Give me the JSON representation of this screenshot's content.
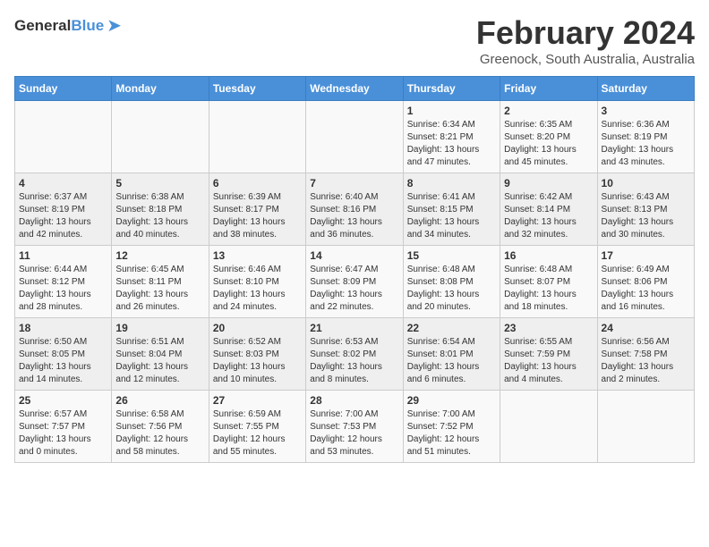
{
  "logo": {
    "general": "General",
    "blue": "Blue"
  },
  "title": "February 2024",
  "subtitle": "Greenock, South Australia, Australia",
  "days_of_week": [
    "Sunday",
    "Monday",
    "Tuesday",
    "Wednesday",
    "Thursday",
    "Friday",
    "Saturday"
  ],
  "weeks": [
    [
      {
        "day": "",
        "detail": ""
      },
      {
        "day": "",
        "detail": ""
      },
      {
        "day": "",
        "detail": ""
      },
      {
        "day": "",
        "detail": ""
      },
      {
        "day": "1",
        "detail": "Sunrise: 6:34 AM\nSunset: 8:21 PM\nDaylight: 13 hours and 47 minutes."
      },
      {
        "day": "2",
        "detail": "Sunrise: 6:35 AM\nSunset: 8:20 PM\nDaylight: 13 hours and 45 minutes."
      },
      {
        "day": "3",
        "detail": "Sunrise: 6:36 AM\nSunset: 8:19 PM\nDaylight: 13 hours and 43 minutes."
      }
    ],
    [
      {
        "day": "4",
        "detail": "Sunrise: 6:37 AM\nSunset: 8:19 PM\nDaylight: 13 hours and 42 minutes."
      },
      {
        "day": "5",
        "detail": "Sunrise: 6:38 AM\nSunset: 8:18 PM\nDaylight: 13 hours and 40 minutes."
      },
      {
        "day": "6",
        "detail": "Sunrise: 6:39 AM\nSunset: 8:17 PM\nDaylight: 13 hours and 38 minutes."
      },
      {
        "day": "7",
        "detail": "Sunrise: 6:40 AM\nSunset: 8:16 PM\nDaylight: 13 hours and 36 minutes."
      },
      {
        "day": "8",
        "detail": "Sunrise: 6:41 AM\nSunset: 8:15 PM\nDaylight: 13 hours and 34 minutes."
      },
      {
        "day": "9",
        "detail": "Sunrise: 6:42 AM\nSunset: 8:14 PM\nDaylight: 13 hours and 32 minutes."
      },
      {
        "day": "10",
        "detail": "Sunrise: 6:43 AM\nSunset: 8:13 PM\nDaylight: 13 hours and 30 minutes."
      }
    ],
    [
      {
        "day": "11",
        "detail": "Sunrise: 6:44 AM\nSunset: 8:12 PM\nDaylight: 13 hours and 28 minutes."
      },
      {
        "day": "12",
        "detail": "Sunrise: 6:45 AM\nSunset: 8:11 PM\nDaylight: 13 hours and 26 minutes."
      },
      {
        "day": "13",
        "detail": "Sunrise: 6:46 AM\nSunset: 8:10 PM\nDaylight: 13 hours and 24 minutes."
      },
      {
        "day": "14",
        "detail": "Sunrise: 6:47 AM\nSunset: 8:09 PM\nDaylight: 13 hours and 22 minutes."
      },
      {
        "day": "15",
        "detail": "Sunrise: 6:48 AM\nSunset: 8:08 PM\nDaylight: 13 hours and 20 minutes."
      },
      {
        "day": "16",
        "detail": "Sunrise: 6:48 AM\nSunset: 8:07 PM\nDaylight: 13 hours and 18 minutes."
      },
      {
        "day": "17",
        "detail": "Sunrise: 6:49 AM\nSunset: 8:06 PM\nDaylight: 13 hours and 16 minutes."
      }
    ],
    [
      {
        "day": "18",
        "detail": "Sunrise: 6:50 AM\nSunset: 8:05 PM\nDaylight: 13 hours and 14 minutes."
      },
      {
        "day": "19",
        "detail": "Sunrise: 6:51 AM\nSunset: 8:04 PM\nDaylight: 13 hours and 12 minutes."
      },
      {
        "day": "20",
        "detail": "Sunrise: 6:52 AM\nSunset: 8:03 PM\nDaylight: 13 hours and 10 minutes."
      },
      {
        "day": "21",
        "detail": "Sunrise: 6:53 AM\nSunset: 8:02 PM\nDaylight: 13 hours and 8 minutes."
      },
      {
        "day": "22",
        "detail": "Sunrise: 6:54 AM\nSunset: 8:01 PM\nDaylight: 13 hours and 6 minutes."
      },
      {
        "day": "23",
        "detail": "Sunrise: 6:55 AM\nSunset: 7:59 PM\nDaylight: 13 hours and 4 minutes."
      },
      {
        "day": "24",
        "detail": "Sunrise: 6:56 AM\nSunset: 7:58 PM\nDaylight: 13 hours and 2 minutes."
      }
    ],
    [
      {
        "day": "25",
        "detail": "Sunrise: 6:57 AM\nSunset: 7:57 PM\nDaylight: 13 hours and 0 minutes."
      },
      {
        "day": "26",
        "detail": "Sunrise: 6:58 AM\nSunset: 7:56 PM\nDaylight: 12 hours and 58 minutes."
      },
      {
        "day": "27",
        "detail": "Sunrise: 6:59 AM\nSunset: 7:55 PM\nDaylight: 12 hours and 55 minutes."
      },
      {
        "day": "28",
        "detail": "Sunrise: 7:00 AM\nSunset: 7:53 PM\nDaylight: 12 hours and 53 minutes."
      },
      {
        "day": "29",
        "detail": "Sunrise: 7:00 AM\nSunset: 7:52 PM\nDaylight: 12 hours and 51 minutes."
      },
      {
        "day": "",
        "detail": ""
      },
      {
        "day": "",
        "detail": ""
      }
    ]
  ]
}
